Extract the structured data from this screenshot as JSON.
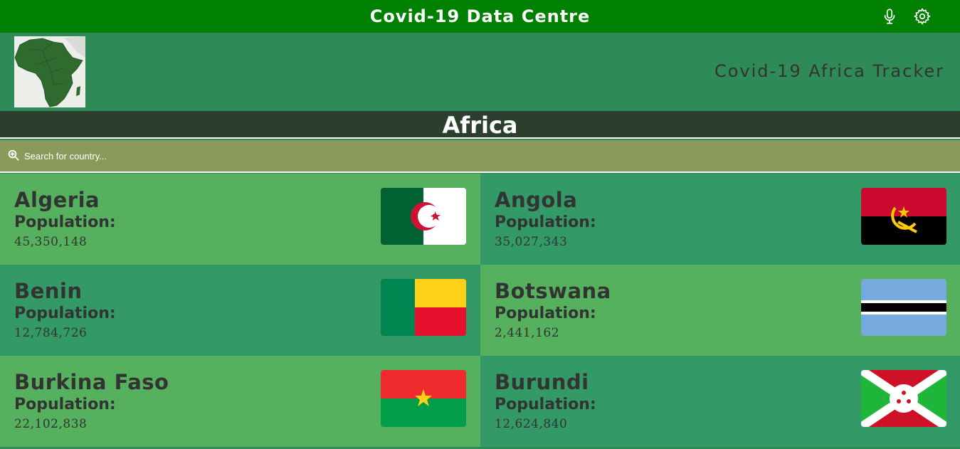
{
  "app": {
    "title": "Covid-19 Data Centre",
    "tracker_title": "Covid-19 Africa Tracker",
    "region": "Africa",
    "icons": [
      "microphone-icon",
      "gear-icon"
    ]
  },
  "search": {
    "placeholder": "Search for country..."
  },
  "colors": {
    "topbar": "#008000",
    "header": "#2e8b57",
    "region_bar": "#2c3f2e",
    "search_bar": "#8a9a5b",
    "card_light": "#56b15e",
    "card_dark": "#339966"
  },
  "countries": [
    {
      "name": "Algeria",
      "population_label": "Population:",
      "population": "45,350,148"
    },
    {
      "name": "Angola",
      "population_label": "Population:",
      "population": "35,027,343"
    },
    {
      "name": "Benin",
      "population_label": "Population:",
      "population": "12,784,726"
    },
    {
      "name": "Botswana",
      "population_label": "Population:",
      "population": "2,441,162"
    },
    {
      "name": "Burkina Faso",
      "population_label": "Population:",
      "population": "22,102,838"
    },
    {
      "name": "Burundi",
      "population_label": "Population:",
      "population": "12,624,840"
    }
  ]
}
